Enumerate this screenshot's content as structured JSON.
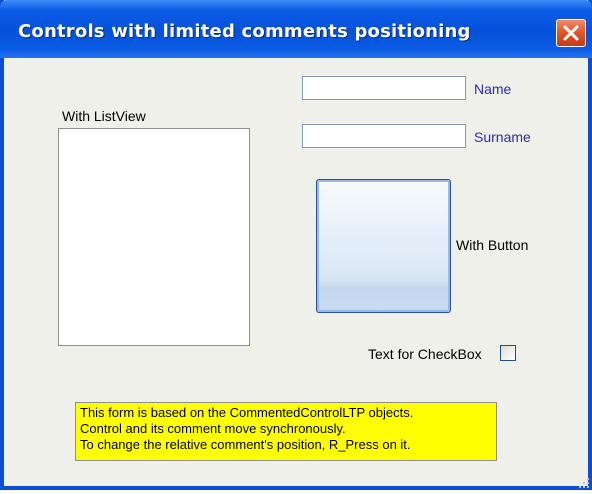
{
  "window": {
    "title": "Controls with limited comments positioning",
    "close_icon": "close-icon"
  },
  "fields": {
    "name": {
      "value": "",
      "comment": "Name"
    },
    "surname": {
      "value": "",
      "comment": "Surname"
    }
  },
  "listview": {
    "comment": "With ListView"
  },
  "button": {
    "comment": "With Button",
    "label": ""
  },
  "checkbox": {
    "comment": "Text for CheckBox",
    "checked": false
  },
  "info": {
    "lines": [
      "This form is based on the CommentedControlLTP objects.",
      "Control and its comment move synchronously.",
      "To change the relative comment's position, R_Press on it."
    ]
  },
  "colors": {
    "titlebar": "#0550d9",
    "close_button": "#e0532b",
    "comment_blue": "#2b2bb8",
    "note_background": "#ffff00",
    "form_background": "#f0f0ea"
  }
}
